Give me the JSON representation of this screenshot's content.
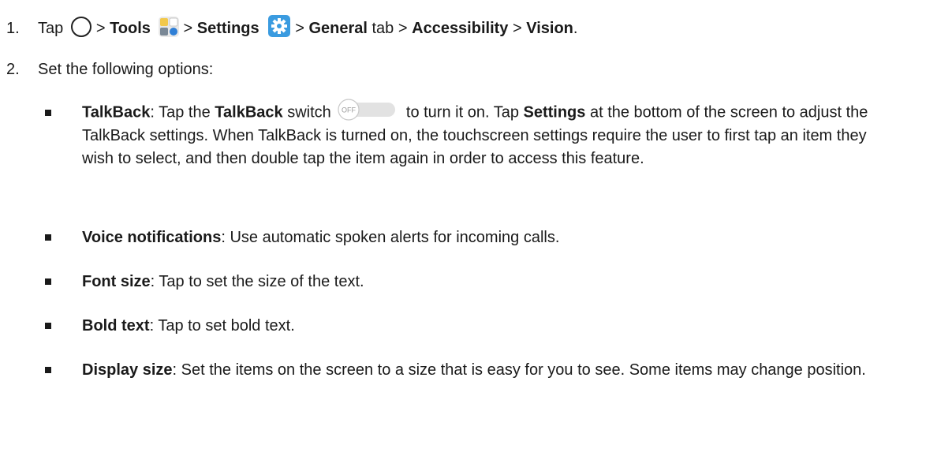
{
  "step1": {
    "number": "1.",
    "tap": "Tap",
    "sep": ">",
    "tools": "Tools",
    "settings": "Settings",
    "general": "General",
    "tab": "tab",
    "accessibility": "Accessibility",
    "vision": "Vision",
    "end": "."
  },
  "step2": {
    "number": "2.",
    "text": "Set the following options:"
  },
  "options": {
    "talkback": {
      "title": "TalkBack",
      "colon": ": Tap the ",
      "switch_label": "TalkBack",
      "switch_word": " switch ",
      "after_switch": " to turn it on. Tap ",
      "settings": "Settings",
      "rest": " at the bottom of the screen to adjust the TalkBack settings. When TalkBack is turned on, the touchscreen settings require the user to first tap an item they wish to select, and then double tap the item again in order to access this feature.",
      "switch_state": "OFF"
    },
    "voice": {
      "title": "Voice notifications",
      "text": ": Use automatic spoken alerts for incoming calls."
    },
    "font_size": {
      "title": "Font size",
      "text": ": Tap to set the size of the text."
    },
    "bold_text": {
      "title": "Bold text",
      "text": ": Tap to set bold text."
    },
    "display_size": {
      "title": "Display size",
      "text": ": Set the items on the screen to a size that is easy for you to see. Some items may change position."
    }
  },
  "colors": {
    "text": "#1a1a1a",
    "tools_tile_yellow": "#f2c84b",
    "tools_tile_blue": "#2f7fd6",
    "gear_bg": "#3a9be0"
  }
}
